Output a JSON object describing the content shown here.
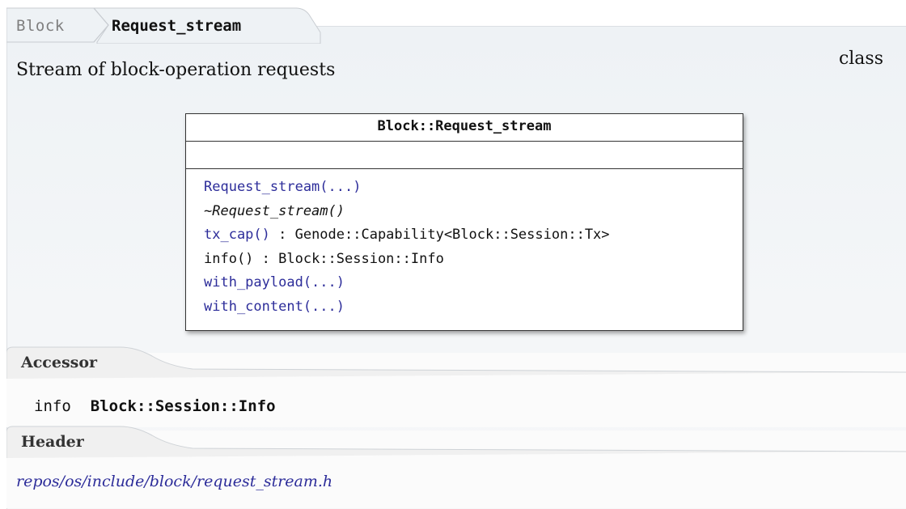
{
  "breadcrumb": {
    "parent": "Block",
    "current": "Request_stream"
  },
  "summary": "Stream of block-operation requests",
  "kind": "class",
  "uml": {
    "title": "Block::Request_stream",
    "operations": [
      {
        "name": "Request_stream(...)",
        "signature": "",
        "linked": true,
        "italic": false
      },
      {
        "name": "~Request_stream()",
        "signature": "",
        "linked": false,
        "italic": true
      },
      {
        "name": "tx_cap()",
        "signature": " : Genode::Capability<Block::Session::Tx>",
        "linked": true,
        "italic": false
      },
      {
        "name": "info()",
        "signature": " : Block::Session::Info",
        "linked": false,
        "italic": false
      },
      {
        "name": "with_payload(...)",
        "signature": "",
        "linked": true,
        "italic": false
      },
      {
        "name": "with_content(...)",
        "signature": "",
        "linked": true,
        "italic": false
      }
    ]
  },
  "accessor": {
    "heading": "Accessor",
    "name": "info",
    "type": "Block::Session::Info"
  },
  "header": {
    "heading": "Header",
    "path": "repos/os/include/block/request_stream.h"
  },
  "colors": {
    "link": "#2d2d9a",
    "panel": "#eef2f5"
  }
}
